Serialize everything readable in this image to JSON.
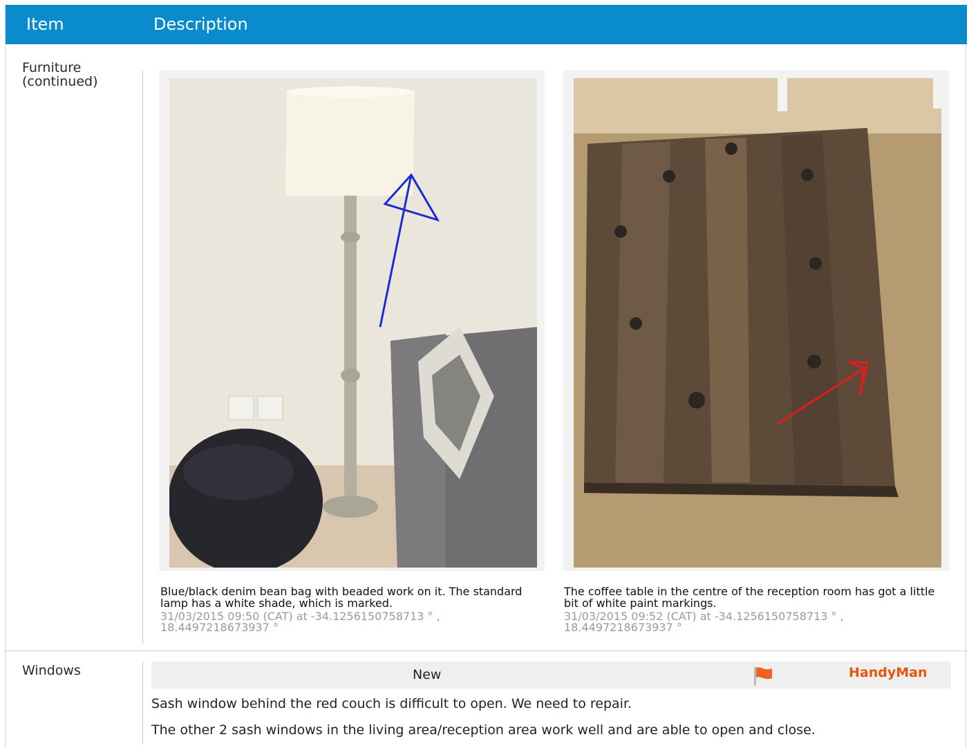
{
  "header": {
    "item_label": "Item",
    "description_label": "Description"
  },
  "rows": [
    {
      "label": "Furniture (continued)",
      "photos": [
        {
          "caption": "Blue/black denim bean bag with beaded work on it. The standard lamp has a white shade, which is marked.",
          "meta": "31/03/2015 09:50 (CAT) at -34.1256150758713 ° , 18.4497218673937 °"
        },
        {
          "caption": "The coffee table in the centre of the reception room has got a little bit of white paint markings.",
          "meta": "31/03/2015 09:52 (CAT) at -34.1256150758713 ° , 18.4497218673937 °"
        }
      ]
    },
    {
      "label": "Windows",
      "status": "New",
      "flag_icon": "flag-icon",
      "flag_color": "#f2621e",
      "assignee": "HandyMan",
      "notes": [
        "Sash window behind the red couch is difficult to open. We need to repair.",
        "The other 2 sash windows in the living area/reception area work well and are able to open and close."
      ]
    }
  ],
  "colors": {
    "header_bg": "#0a8bcc",
    "accent": "#e8540c"
  }
}
